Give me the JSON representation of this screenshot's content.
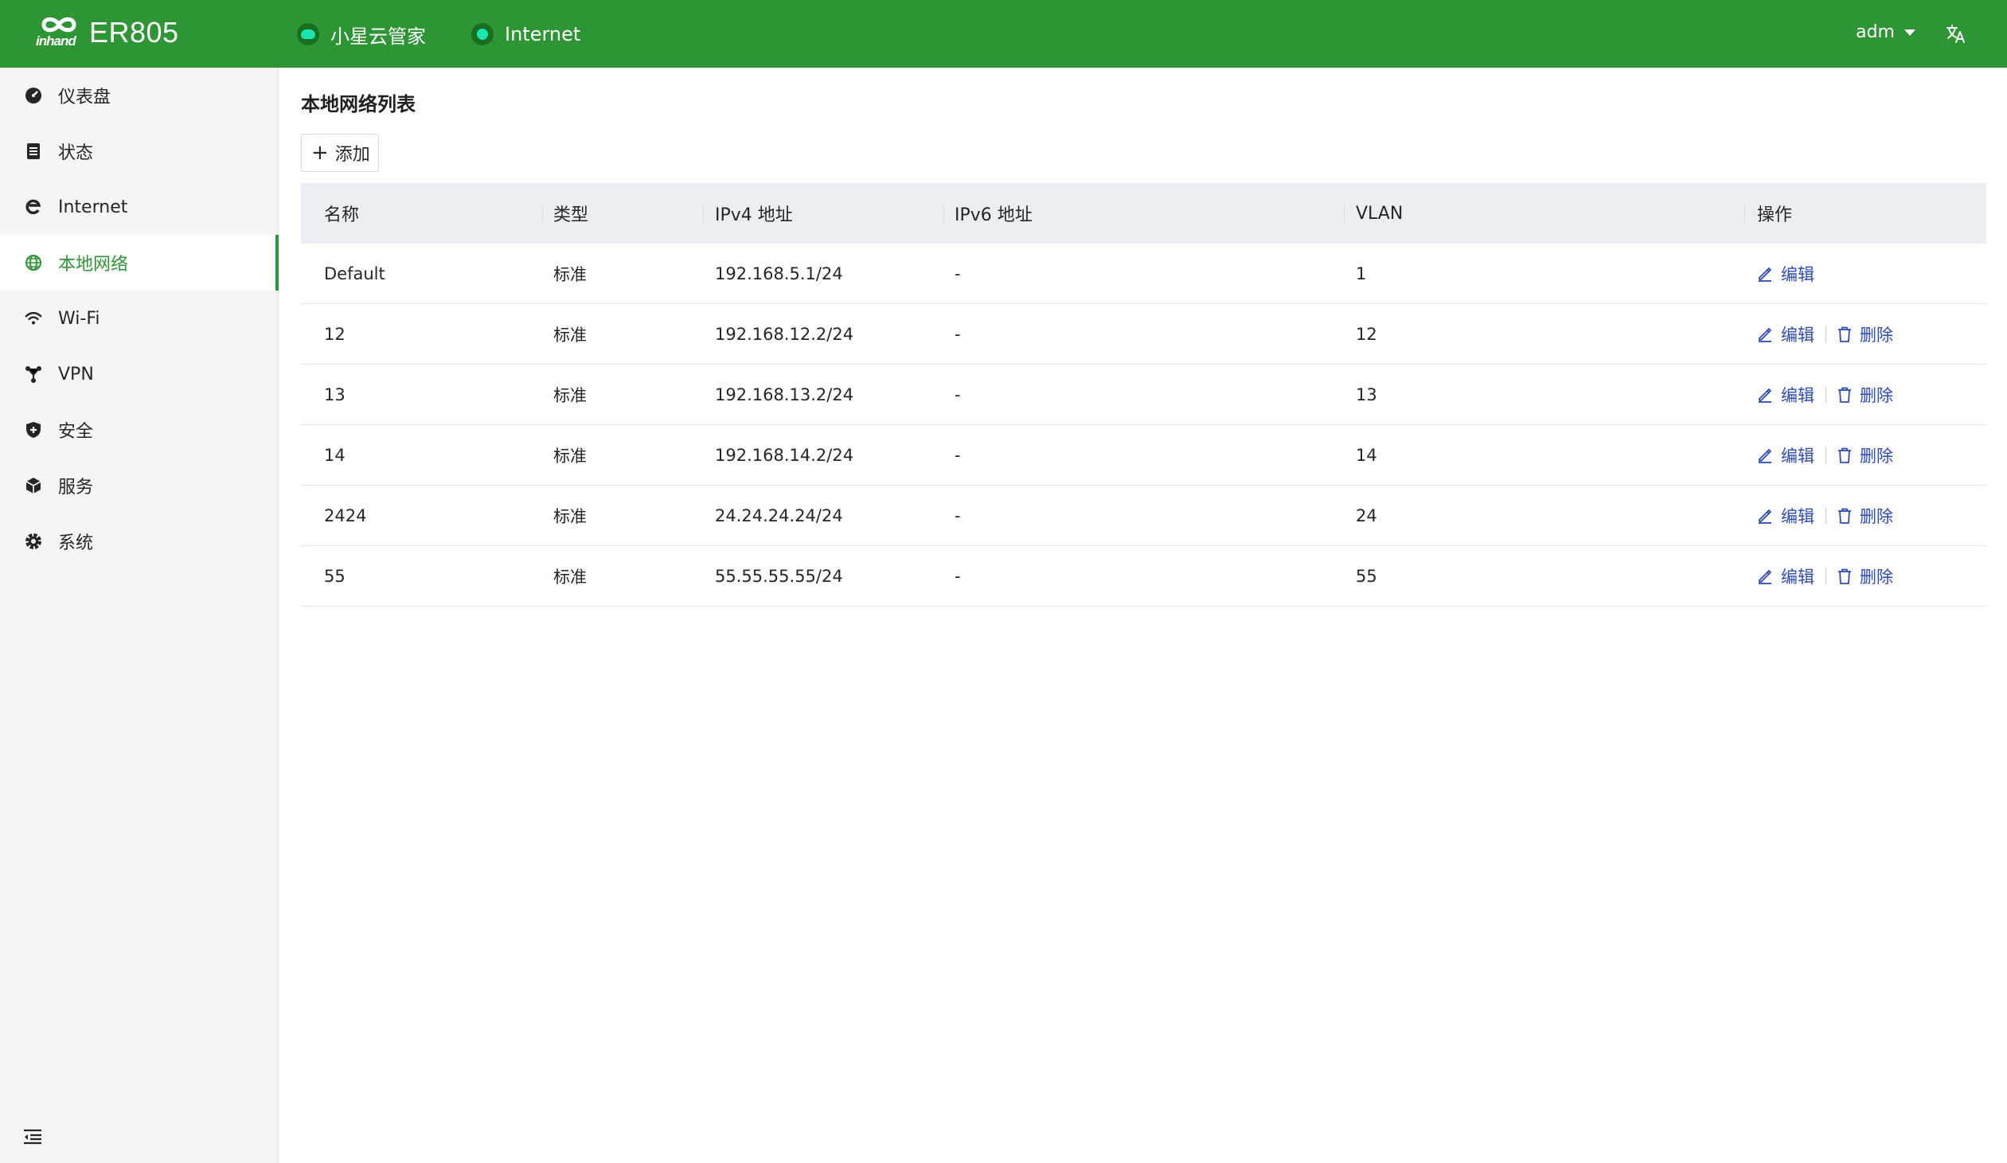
{
  "header": {
    "logo_brand": "inhand",
    "product": "ER805",
    "cloud_label": "小星云管家",
    "internet_label": "Internet",
    "user": "adm",
    "lang_icon": "translate-icon",
    "colors": {
      "primary": "#2e9535",
      "status_dot": "#19e6b1",
      "link": "#2c4bb5"
    }
  },
  "sidebar": {
    "items": [
      {
        "label": "仪表盘",
        "icon": "dashboard-icon"
      },
      {
        "label": "状态",
        "icon": "status-list-icon"
      },
      {
        "label": "Internet",
        "icon": "internet-icon"
      },
      {
        "label": "本地网络",
        "icon": "globe-icon",
        "active": true
      },
      {
        "label": "Wi-Fi",
        "icon": "wifi-icon"
      },
      {
        "label": "VPN",
        "icon": "vpn-icon"
      },
      {
        "label": "安全",
        "icon": "shield-icon"
      },
      {
        "label": "服务",
        "icon": "cube-icon"
      },
      {
        "label": "系统",
        "icon": "gear-icon"
      }
    ],
    "collapse_icon": "collapse-menu-icon"
  },
  "main": {
    "title": "本地网络列表",
    "add_label": "添加",
    "columns": [
      "名称",
      "类型",
      "IPv4 地址",
      "IPv6 地址",
      "VLAN",
      "操作"
    ],
    "edit_label": "编辑",
    "delete_label": "删除",
    "rows": [
      {
        "name": "Default",
        "type": "标准",
        "ipv4": "192.168.5.1/24",
        "ipv6": "-",
        "vlan": "1",
        "deletable": false
      },
      {
        "name": "12",
        "type": "标准",
        "ipv4": "192.168.12.2/24",
        "ipv6": "-",
        "vlan": "12",
        "deletable": true
      },
      {
        "name": "13",
        "type": "标准",
        "ipv4": "192.168.13.2/24",
        "ipv6": "-",
        "vlan": "13",
        "deletable": true
      },
      {
        "name": "14",
        "type": "标准",
        "ipv4": "192.168.14.2/24",
        "ipv6": "-",
        "vlan": "14",
        "deletable": true
      },
      {
        "name": "2424",
        "type": "标准",
        "ipv4": "24.24.24.24/24",
        "ipv6": "-",
        "vlan": "24",
        "deletable": true
      },
      {
        "name": "55",
        "type": "标准",
        "ipv4": "55.55.55.55/24",
        "ipv6": "-",
        "vlan": "55",
        "deletable": true
      }
    ]
  }
}
